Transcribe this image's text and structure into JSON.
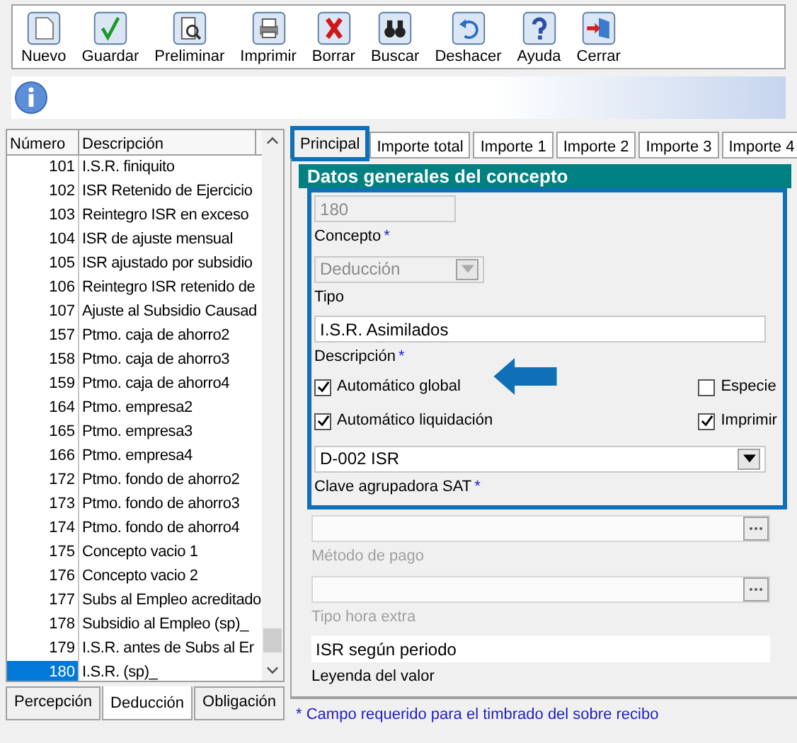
{
  "toolbar": [
    {
      "label": "Nuevo",
      "kind": "new"
    },
    {
      "label": "Guardar",
      "kind": "save"
    },
    {
      "label": "Preliminar",
      "kind": "preview"
    },
    {
      "label": "Imprimir",
      "kind": "print"
    },
    {
      "label": "Borrar",
      "kind": "delete"
    },
    {
      "label": "Buscar",
      "kind": "find"
    },
    {
      "label": "Deshacer",
      "kind": "undo"
    },
    {
      "label": "Ayuda",
      "kind": "help"
    },
    {
      "label": "Cerrar",
      "kind": "close"
    }
  ],
  "list": {
    "columns": [
      "Número",
      "Descripción"
    ],
    "rows": [
      {
        "number": "101",
        "description": "I.S.R. finiquito",
        "selected": false
      },
      {
        "number": "102",
        "description": "ISR Retenido de Ejercicio",
        "selected": false
      },
      {
        "number": "103",
        "description": "Reintegro ISR en exceso",
        "selected": false
      },
      {
        "number": "104",
        "description": "ISR de ajuste mensual",
        "selected": false
      },
      {
        "number": "105",
        "description": "ISR ajustado por subsidio",
        "selected": false
      },
      {
        "number": "106",
        "description": "Reintegro ISR retenido de",
        "selected": false
      },
      {
        "number": "107",
        "description": "Ajuste al Subsidio Causad",
        "selected": false
      },
      {
        "number": "157",
        "description": "Ptmo. caja de ahorro2",
        "selected": false
      },
      {
        "number": "158",
        "description": "Ptmo. caja de ahorro3",
        "selected": false
      },
      {
        "number": "159",
        "description": "Ptmo. caja de ahorro4",
        "selected": false
      },
      {
        "number": "164",
        "description": "Ptmo. empresa2",
        "selected": false
      },
      {
        "number": "165",
        "description": "Ptmo. empresa3",
        "selected": false
      },
      {
        "number": "166",
        "description": "Ptmo. empresa4",
        "selected": false
      },
      {
        "number": "172",
        "description": "Ptmo. fondo de ahorro2",
        "selected": false
      },
      {
        "number": "173",
        "description": "Ptmo. fondo de ahorro3",
        "selected": false
      },
      {
        "number": "174",
        "description": "Ptmo. fondo de ahorro4",
        "selected": false
      },
      {
        "number": "175",
        "description": "Concepto vacio 1",
        "selected": false
      },
      {
        "number": "176",
        "description": "Concepto vacio 2",
        "selected": false
      },
      {
        "number": "177",
        "description": "Subs al Empleo acreditado",
        "selected": false
      },
      {
        "number": "178",
        "description": "Subsidio al Empleo (sp)_",
        "selected": false
      },
      {
        "number": "179",
        "description": "I.S.R. antes de Subs al Er",
        "selected": false
      },
      {
        "number": "180",
        "description": "I.S.R. (sp)_",
        "selected": true
      }
    ]
  },
  "bottom_tabs": [
    {
      "label": "Percepción",
      "selected": false
    },
    {
      "label": "Deducción",
      "selected": true
    },
    {
      "label": "Obligación",
      "selected": false
    }
  ],
  "tabs": [
    {
      "label": "Principal",
      "selected": true
    },
    {
      "label": "Importe total",
      "selected": false
    },
    {
      "label": "Importe 1",
      "selected": false
    },
    {
      "label": "Importe 2",
      "selected": false
    },
    {
      "label": "Importe 3",
      "selected": false
    },
    {
      "label": "Importe 4",
      "selected": false
    }
  ],
  "section_title": "Datos generales del concepto",
  "highlight_box": {
    "fields": [
      {
        "kind": "input",
        "value": "180",
        "label": "Concepto",
        "required_mark": "*",
        "disabled": true
      },
      {
        "kind": "select",
        "value": "Deducción",
        "label": "Tipo",
        "disabled": true
      },
      {
        "kind": "input",
        "value": "I.S.R. Asimilados",
        "label": "Descripción",
        "required_mark": "*",
        "disabled": false
      },
      {
        "kind": "checks",
        "checks": [
          {
            "label": "Automático global",
            "checked": true
          },
          {
            "label": "Especie",
            "checked": false
          },
          {
            "label": "Automático liquidación",
            "checked": true
          },
          {
            "label": "Imprimir",
            "checked": true
          }
        ]
      },
      {
        "kind": "select",
        "value": "D-002  ISR",
        "label": "Clave agrupadora SAT",
        "required_mark": "*",
        "disabled": false
      }
    ]
  },
  "fields": [
    {
      "kind": "browse",
      "label": "Método de pago",
      "disabled": true
    },
    {
      "kind": "browse",
      "label": "Tipo hora extra",
      "disabled": true
    },
    {
      "kind": "static",
      "value": "ISR según periodo",
      "label": "Leyenda del valor",
      "disabled": false
    }
  ],
  "footer_note": "* Campo requerido para el timbrado del sobre recibo"
}
